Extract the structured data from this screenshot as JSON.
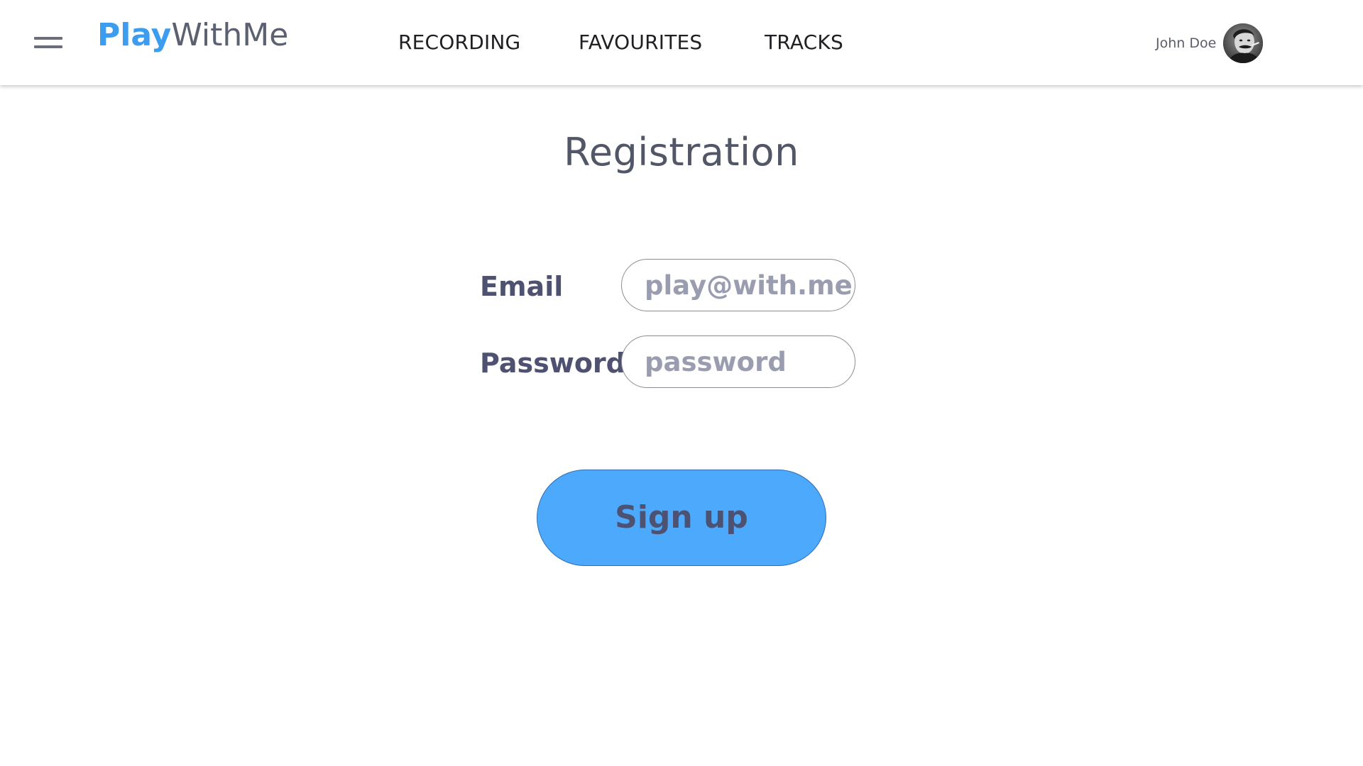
{
  "header": {
    "menu_icon": "hamburger-menu-icon",
    "logo": {
      "part1": "Play",
      "part2": "WithMe"
    },
    "nav": [
      {
        "label": "RECORDING"
      },
      {
        "label": "FAVOURITES"
      },
      {
        "label": "TRACKS"
      }
    ],
    "user": {
      "name": "John Doe",
      "avatar_icon": "user-avatar-icon"
    }
  },
  "main": {
    "title": "Registration",
    "form": {
      "email": {
        "label": "Email",
        "placeholder": "play@with.me",
        "value": ""
      },
      "password": {
        "label": "Password",
        "placeholder": "password",
        "value": ""
      },
      "submit_label": "Sign up"
    }
  },
  "colors": {
    "brand_blue": "#3b9cf0",
    "button_blue": "#4ca9fc",
    "label_text": "#4e5270",
    "title_text": "#515766"
  }
}
